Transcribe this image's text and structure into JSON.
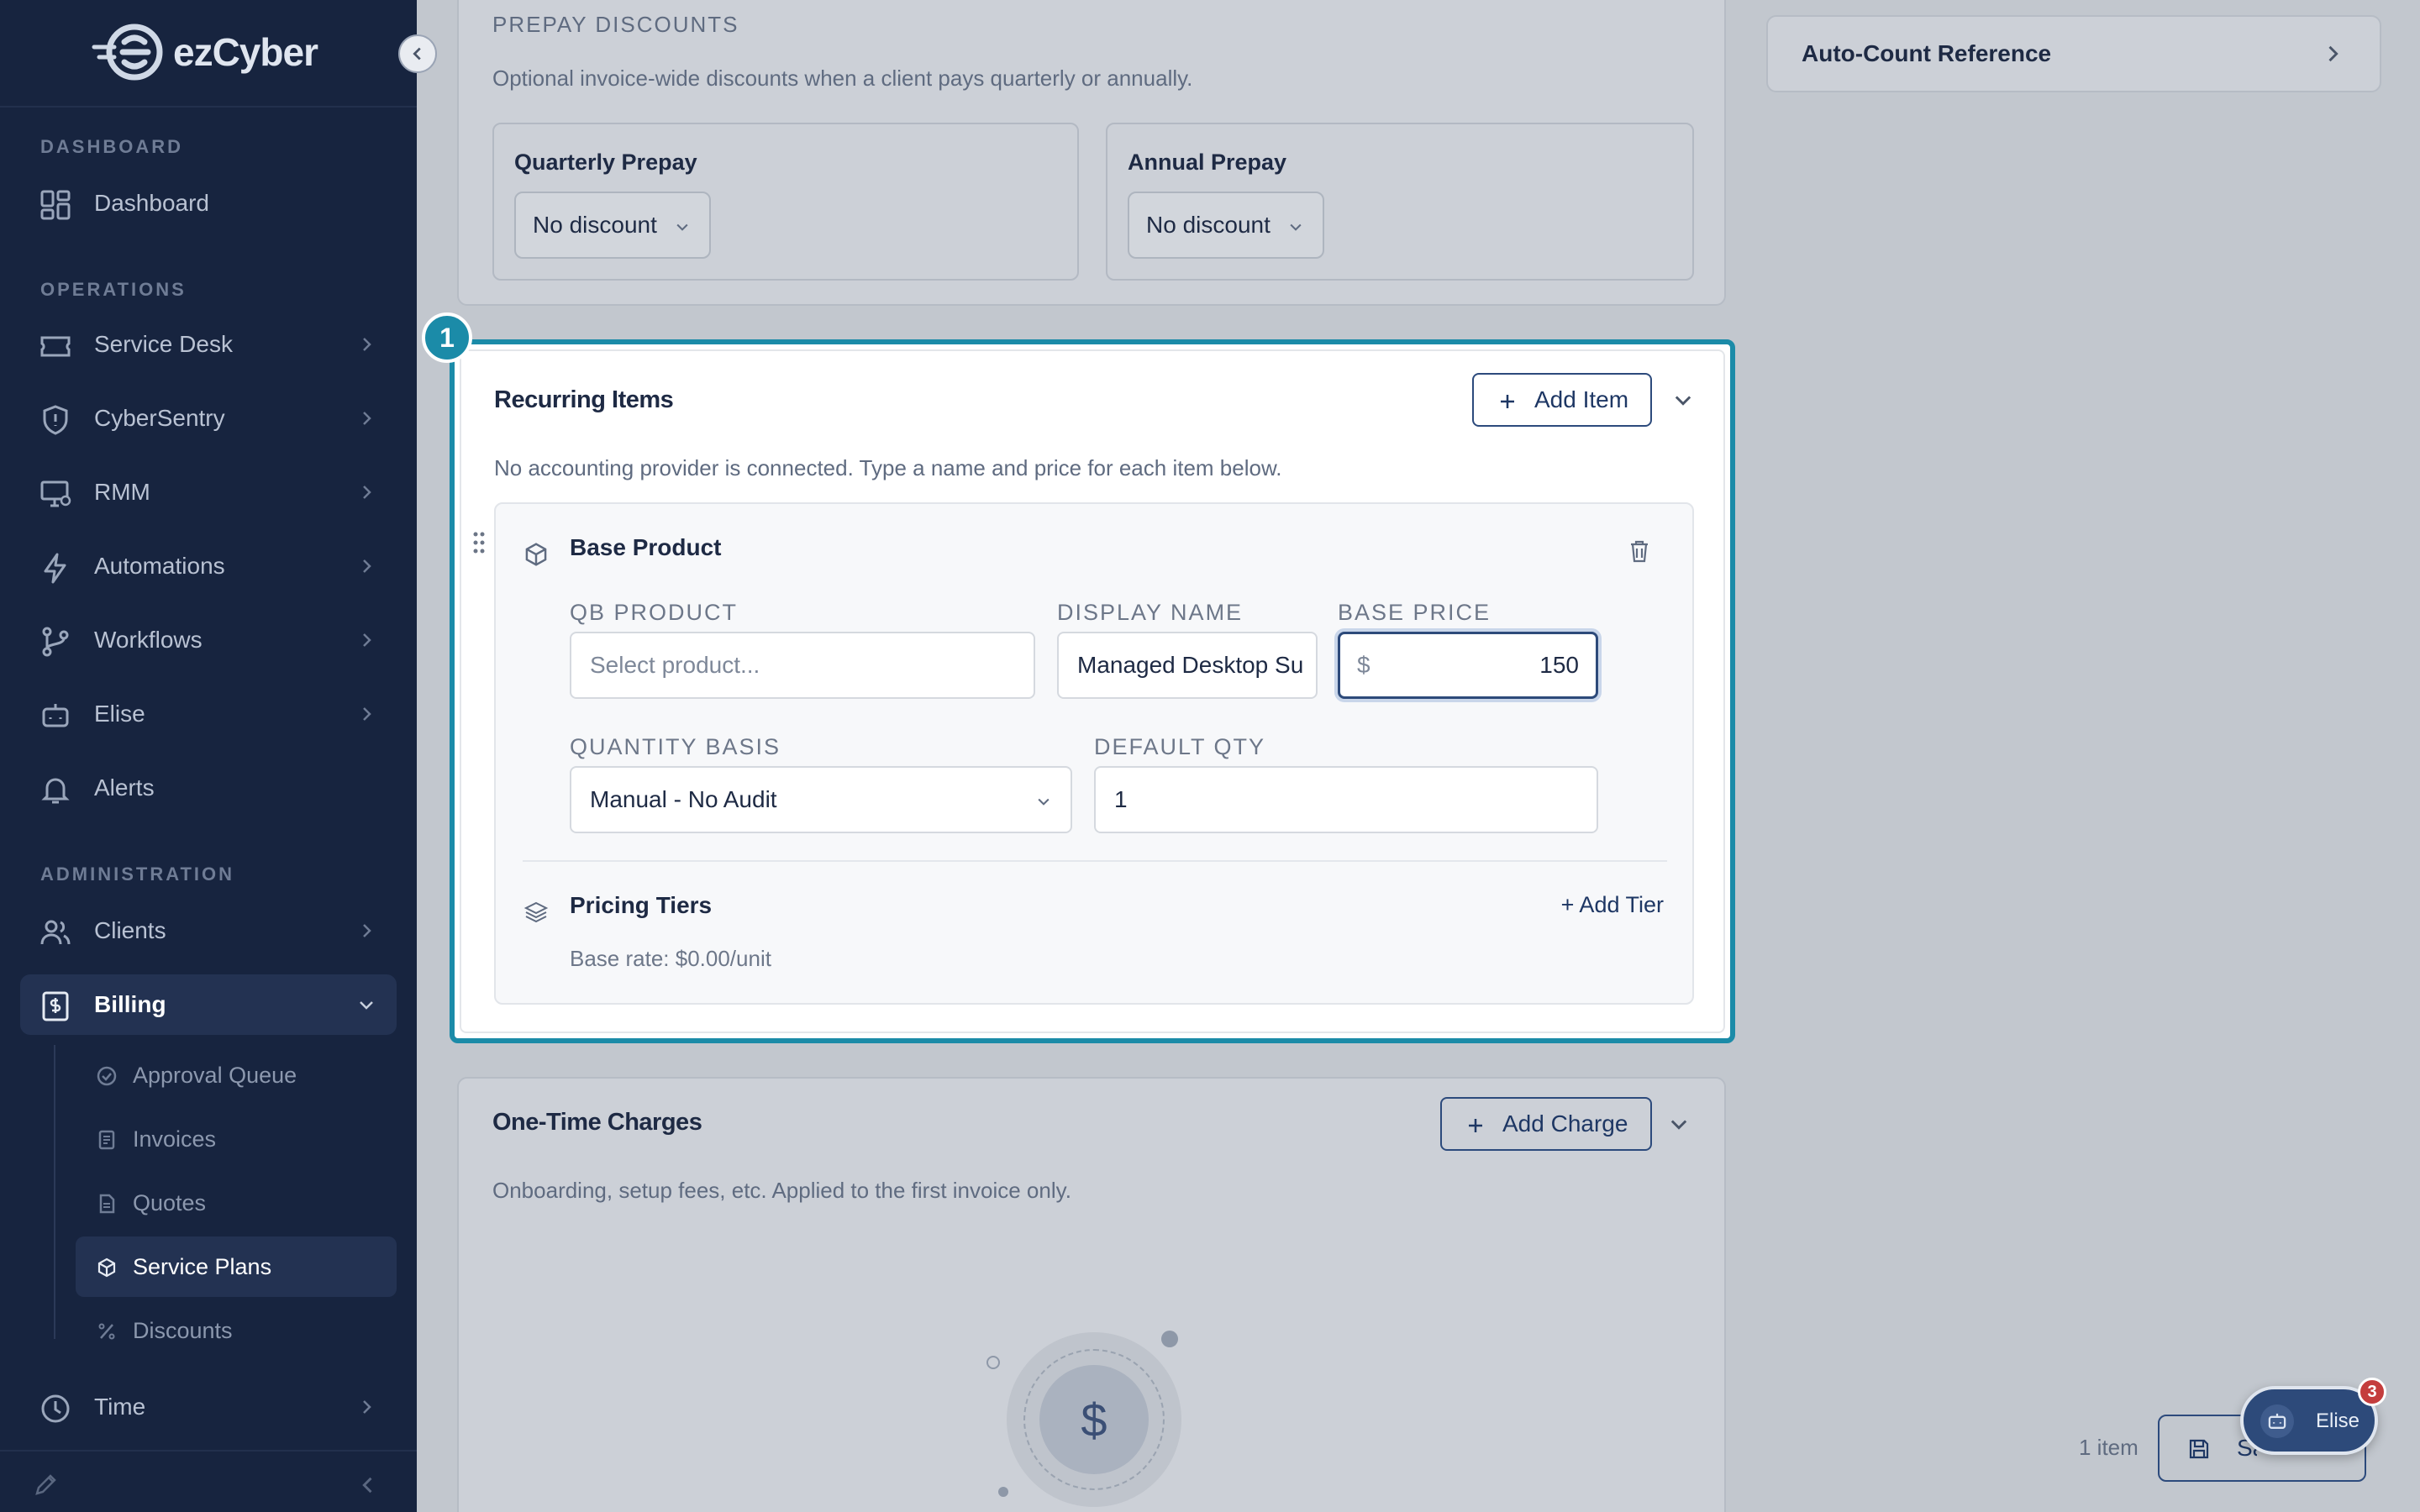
{
  "sidebar": {
    "brand": "ezCyber",
    "sections": {
      "dashboard": "DASHBOARD",
      "operations": "OPERATIONS",
      "administration": "ADMINISTRATION"
    },
    "items": {
      "dashboard": "Dashboard",
      "service_desk": "Service Desk",
      "cybersentry": "CyberSentry",
      "rmm": "RMM",
      "automations": "Automations",
      "workflows": "Workflows",
      "elise": "Elise",
      "alerts": "Alerts",
      "clients": "Clients",
      "billing": "Billing",
      "time": "Time"
    },
    "billing_sub": {
      "approval_queue": "Approval Queue",
      "invoices": "Invoices",
      "quotes": "Quotes",
      "service_plans": "Service Plans",
      "discounts": "Discounts"
    }
  },
  "prepay": {
    "title": "PREPAY DISCOUNTS",
    "description": "Optional invoice-wide discounts when a client pays quarterly or annually.",
    "quarterly_label": "Quarterly Prepay",
    "quarterly_value": "No discount",
    "annual_label": "Annual Prepay",
    "annual_value": "No discount"
  },
  "recurring": {
    "step": "1",
    "title": "Recurring Items",
    "add_button": "Add Item",
    "description": "No accounting provider is connected. Type a name and price for each item below.",
    "item": {
      "title": "Base Product",
      "qb_product_label": "QB PRODUCT",
      "qb_product_placeholder": "Select product...",
      "display_name_label": "DISPLAY NAME",
      "display_name_value": "Managed Desktop Su",
      "base_price_label": "BASE PRICE",
      "currency": "$",
      "base_price_value": "150",
      "quantity_basis_label": "QUANTITY BASIS",
      "quantity_basis_value": "Manual - No Audit",
      "default_qty_label": "DEFAULT QTY",
      "default_qty_value": "1",
      "pricing_tiers_title": "Pricing Tiers",
      "add_tier": "+ Add Tier",
      "base_rate": "Base rate: $0.00/unit"
    }
  },
  "one_time": {
    "title": "One-Time Charges",
    "add_button": "Add Charge",
    "description": "Onboarding, setup fees, etc. Applied to the first invoice only.",
    "empty_icon": "$"
  },
  "right_panel": {
    "auto_count_title": "Auto-Count Reference"
  },
  "footer": {
    "item_count": "1 item",
    "save_label": "Save"
  },
  "chat": {
    "label": "Elise",
    "badge": "3"
  },
  "colors": {
    "sidebar_bg": "#17243f",
    "highlight": "#1b8ba8",
    "overlay_bg": "#c2c7ce",
    "primary_text": "#1e3764"
  }
}
